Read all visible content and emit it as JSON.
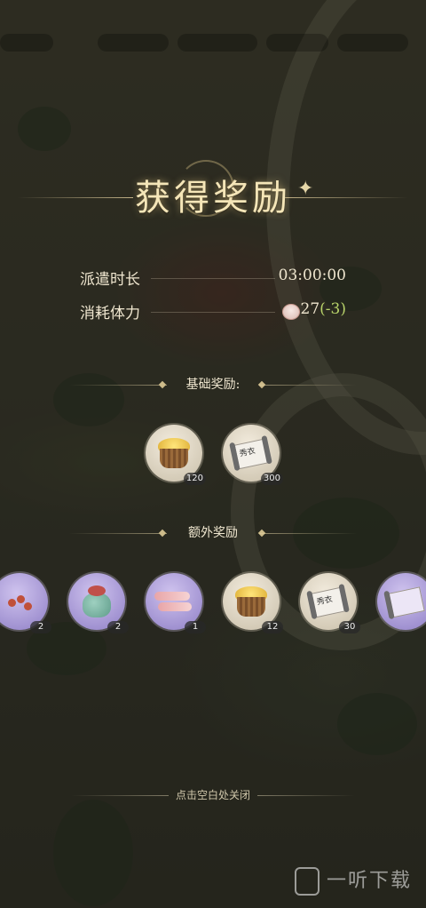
{
  "title": "获得奖励",
  "stats": {
    "duration_label": "派遣时长",
    "duration_value": "03:00:00",
    "stamina_label": "消耗体力",
    "stamina_value": "27",
    "stamina_change": "(-3)"
  },
  "basic_rewards": {
    "heading": "基础奖励:",
    "items": [
      {
        "icon": "grain-basket-icon",
        "count": "120"
      },
      {
        "icon": "scroll-icon",
        "count": "300"
      }
    ]
  },
  "extra_rewards": {
    "heading": "额外奖励",
    "items": [
      {
        "icon": "berries-icon",
        "count": "2"
      },
      {
        "icon": "pouch-icon",
        "count": "2"
      },
      {
        "icon": "meat-icon",
        "count": "1"
      },
      {
        "icon": "grain-basket-icon",
        "count": "12"
      },
      {
        "icon": "scroll-icon",
        "count": "30"
      },
      {
        "icon": "purple-scroll-icon",
        "count": ""
      }
    ]
  },
  "scroll_text": "秀衣",
  "close_hint": "点击空白处关闭",
  "watermark": "一听下载",
  "colors": {
    "title": "#f5e6b8",
    "negative": "#b8d36a",
    "purple_frame": "#8f7fc6",
    "beige_frame": "#c9bfa9"
  }
}
